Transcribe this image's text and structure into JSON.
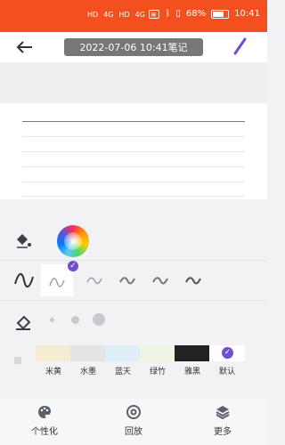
{
  "status_bar": {
    "left_indicators": [
      "HD",
      "HD",
      "4G",
      "4G"
    ],
    "battery": "68%",
    "time": "10:41"
  },
  "header": {
    "title": "2022-07-06 10:41笔记",
    "back_icon": "back-arrow-icon",
    "edit_icon": "pen-icon"
  },
  "background_swatches": [
    {
      "label": "米黄",
      "color": "#f5edd2"
    },
    {
      "label": "水墨",
      "color": "#e2e4e6"
    },
    {
      "label": "蓝天",
      "color": "#dfeff8"
    },
    {
      "label": "绿竹",
      "color": "#eef5e3"
    },
    {
      "label": "雅黑",
      "color": "#222222"
    },
    {
      "label": "默认",
      "color": "#ffffff",
      "selected": true
    }
  ],
  "bottom_nav": [
    {
      "label": "个性化",
      "icon": "palette-icon"
    },
    {
      "label": "回放",
      "icon": "replay-icon"
    },
    {
      "label": "更多",
      "icon": "layers-icon"
    }
  ],
  "colors": {
    "status_bar": "#f4501f",
    "accent": "#6f4fd0",
    "title_pill": "#777777"
  }
}
